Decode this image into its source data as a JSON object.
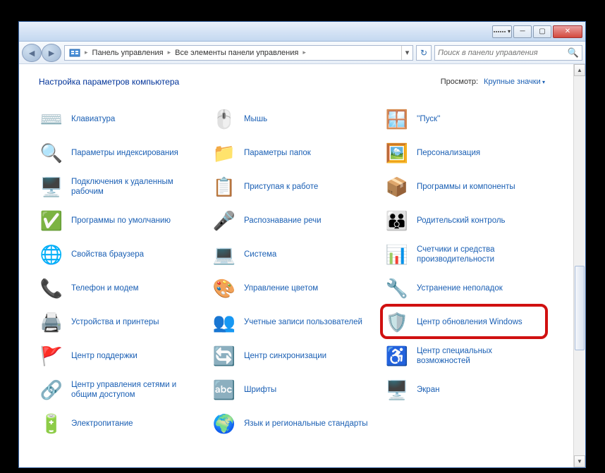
{
  "breadcrumb": {
    "seg1": "Панель управления",
    "seg2": "Все элементы панели управления"
  },
  "search": {
    "placeholder": "Поиск в панели управления"
  },
  "heading": "Настройка параметров компьютера",
  "view": {
    "label": "Просмотр:",
    "value": "Крупные значки"
  },
  "items": {
    "col1": [
      {
        "name": "keyboard",
        "label": "Клавиатура",
        "icon": "⌨️"
      },
      {
        "name": "indexing-options",
        "label": "Параметры индексирования",
        "icon": "🔍"
      },
      {
        "name": "remote-desktop",
        "label": "Подключения к удаленным рабочим",
        "icon": "🖥️"
      },
      {
        "name": "default-programs",
        "label": "Программы по умолчанию",
        "icon": "✅"
      },
      {
        "name": "internet-options",
        "label": "Свойства браузера",
        "icon": "🌐"
      },
      {
        "name": "phone-modem",
        "label": "Телефон и модем",
        "icon": "📞"
      },
      {
        "name": "devices-printers",
        "label": "Устройства и принтеры",
        "icon": "🖨️"
      },
      {
        "name": "action-center",
        "label": "Центр поддержки",
        "icon": "🚩"
      },
      {
        "name": "network-sharing",
        "label": "Центр управления сетями и общим доступом",
        "icon": "🔗"
      },
      {
        "name": "power-options",
        "label": "Электропитание",
        "icon": "🔋"
      }
    ],
    "col2": [
      {
        "name": "mouse",
        "label": "Мышь",
        "icon": "🖱️"
      },
      {
        "name": "folder-options",
        "label": "Параметры папок",
        "icon": "📁"
      },
      {
        "name": "getting-started",
        "label": "Приступая к работе",
        "icon": "📋"
      },
      {
        "name": "speech-recognition",
        "label": "Распознавание речи",
        "icon": "🎤"
      },
      {
        "name": "system",
        "label": "Система",
        "icon": "💻"
      },
      {
        "name": "color-management",
        "label": "Управление цветом",
        "icon": "🎨"
      },
      {
        "name": "user-accounts",
        "label": "Учетные записи пользователей",
        "icon": "👥"
      },
      {
        "name": "sync-center",
        "label": "Центр синхронизации",
        "icon": "🔄"
      },
      {
        "name": "fonts",
        "label": "Шрифты",
        "icon": "🔤"
      },
      {
        "name": "region-language",
        "label": "Язык и региональные стандарты",
        "icon": "🌍"
      }
    ],
    "col3": [
      {
        "name": "taskbar-start",
        "label": "''Пуск''",
        "icon": "🪟"
      },
      {
        "name": "personalization",
        "label": "Персонализация",
        "icon": "🖼️"
      },
      {
        "name": "programs-features",
        "label": "Программы и компоненты",
        "icon": "📦"
      },
      {
        "name": "parental-controls",
        "label": "Родительский контроль",
        "icon": "👪"
      },
      {
        "name": "performance-info",
        "label": "Счетчики и средства производительности",
        "icon": "📊"
      },
      {
        "name": "troubleshooting",
        "label": "Устранение неполадок",
        "icon": "🔧"
      },
      {
        "name": "windows-update",
        "label": "Центр обновления Windows",
        "icon": "🛡️",
        "highlight": true
      },
      {
        "name": "ease-of-access",
        "label": "Центр специальных возможностей",
        "icon": "♿"
      },
      {
        "name": "display",
        "label": "Экран",
        "icon": "🖥️"
      }
    ]
  }
}
